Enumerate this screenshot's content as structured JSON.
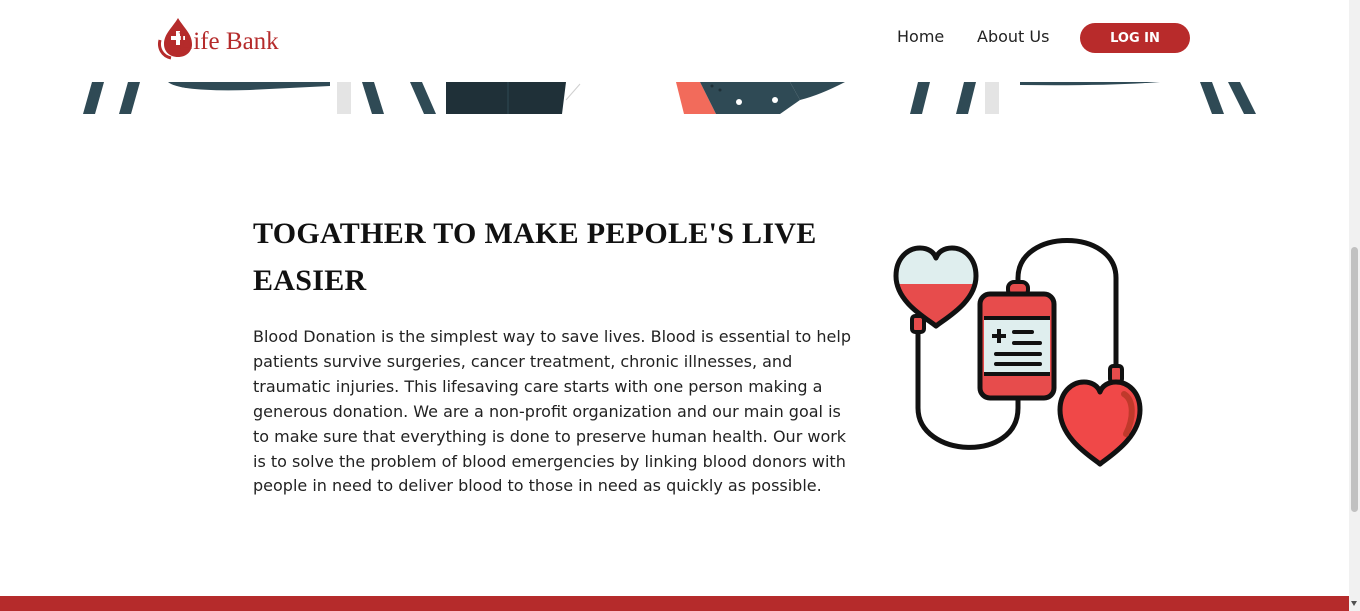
{
  "nav": {
    "logo_text": "Life Bank",
    "home_label": "Home",
    "about_label": "About Us",
    "login_label": "LOG IN"
  },
  "main": {
    "heading": "TOGATHER TO MAKE PEPOLE'S LIVE EASIER",
    "body": "Blood Donation is the simplest way to save lives. Blood is essential to help patients survive surgeries, cancer treatment, chronic illnesses, and traumatic injuries. This lifesaving care starts with one person making a generous donation. We are a non-profit organization and our main goal is to make sure that everything is done to preserve human health. Our work is to solve the problem of blood emergencies by linking blood donors with people in need to deliver blood to those in need as quickly as possible."
  },
  "icons": {
    "logo": "blood-drop-cross-icon",
    "illustration": "blood-transfusion-hearts-icon"
  },
  "colors": {
    "brand_red": "#b52b2b",
    "heart_red": "#f04848",
    "dark_slate": "#2f4a55"
  }
}
